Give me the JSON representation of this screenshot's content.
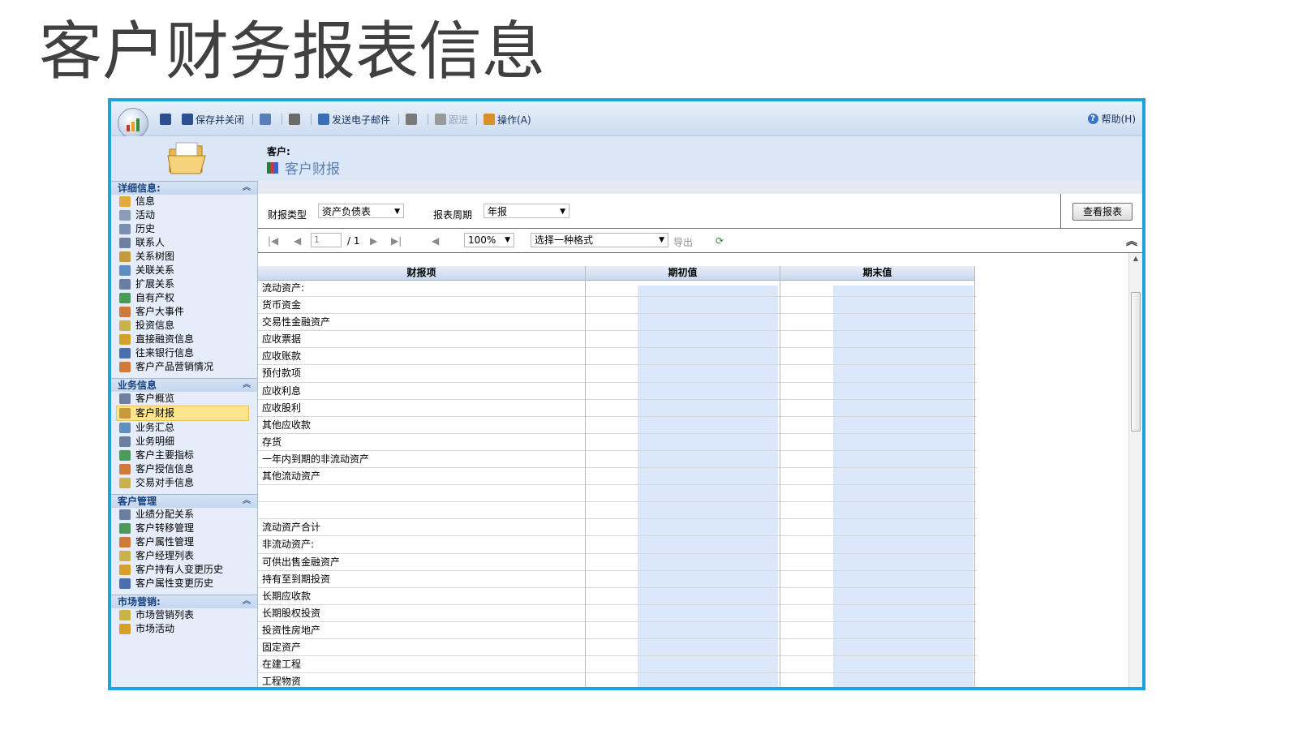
{
  "slide_title": "客户财务报表信息",
  "toolbar": {
    "items": [
      {
        "label": "",
        "icon": "save-icon"
      },
      {
        "label": "保存并关闭",
        "icon": "save-close-icon"
      },
      {
        "label": "",
        "icon": "save-new-icon"
      },
      {
        "label": "",
        "icon": "print-icon"
      },
      {
        "label": "发送电子邮件",
        "icon": "email-icon"
      },
      {
        "label": "",
        "icon": "attach-icon"
      },
      {
        "label": "跟进",
        "icon": "followup-icon"
      },
      {
        "label": "操作(A)",
        "icon": "actions-icon"
      }
    ],
    "help": "帮助(H)"
  },
  "header": {
    "entity_label": "客户:",
    "entity_title": "客户财报"
  },
  "sidebar": {
    "sections": [
      {
        "title": "详细信息:",
        "items": [
          "信息",
          "活动",
          "历史",
          "联系人",
          "关系树图",
          "关联关系",
          "扩展关系",
          "自有产权",
          "客户大事件",
          "投资信息",
          "直接融资信息",
          "往来银行信息",
          "客户产品营销情况"
        ]
      },
      {
        "title": "业务信息",
        "items": [
          "客户概览",
          "客户财报",
          "业务汇总",
          "业务明细",
          "客户主要指标",
          "客户授信信息",
          "交易对手信息"
        ],
        "active": "客户财报"
      },
      {
        "title": "客户管理",
        "items": [
          "业绩分配关系",
          "客户转移管理",
          "客户属性管理",
          "客户经理列表",
          "客户持有人变更历史",
          "客户属性变更历史"
        ]
      },
      {
        "title": "市场营销:",
        "items": [
          "市场营销列表",
          "市场活动"
        ]
      }
    ]
  },
  "filters": {
    "type_label": "财报类型",
    "type_value": "资产负债表",
    "period_label": "报表周期",
    "period_value": "年报",
    "view_button": "查看报表"
  },
  "pager": {
    "page_input": "1",
    "page_total": "/ 1",
    "zoom": "100%",
    "format_select": "选择一种格式",
    "export": "导出"
  },
  "report": {
    "columns": [
      "财报项",
      "期初值",
      "期末值"
    ],
    "rows": [
      "流动资产:",
      "货币资金",
      "交易性金融资产",
      "应收票据",
      "应收账款",
      "预付款项",
      "应收利息",
      "应收股利",
      "其他应收款",
      "存货",
      "一年内到期的非流动资产",
      "其他流动资产",
      "",
      "",
      "流动资产合计",
      "非流动资产:",
      "可供出售金融资产",
      "持有至到期投资",
      "长期应收款",
      "长期股权投资",
      "投资性房地产",
      "固定资产",
      "在建工程",
      "工程物资"
    ]
  },
  "colors": {
    "frame_border": "#1aa3de",
    "nav_active": "#fde58c",
    "value_cell": "#dbe7fa"
  }
}
